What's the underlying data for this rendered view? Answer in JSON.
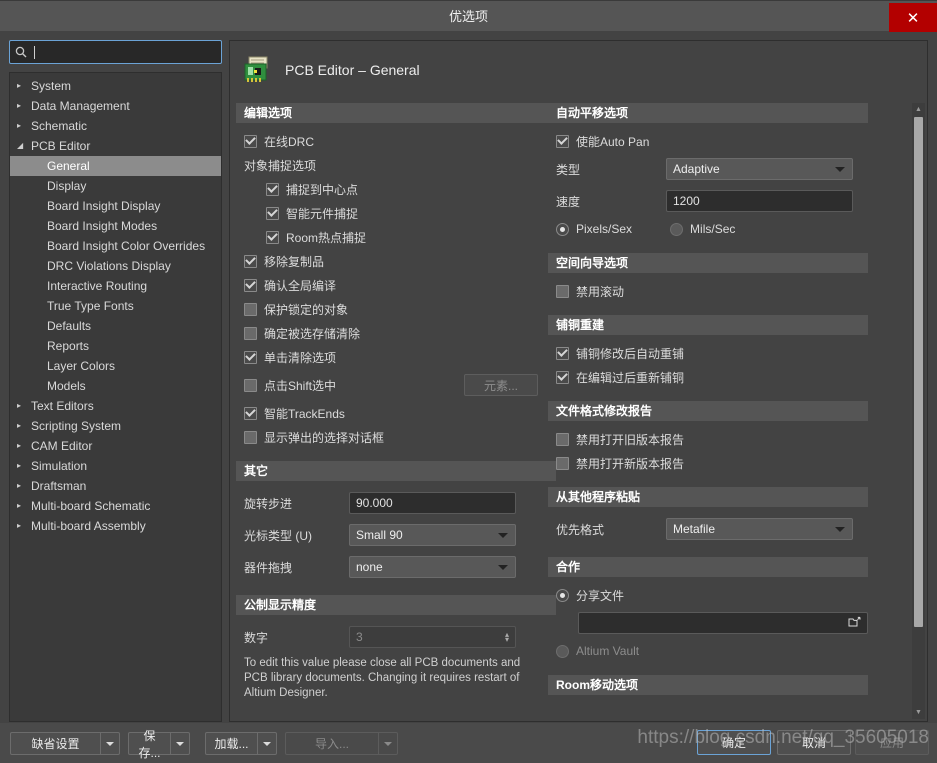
{
  "window": {
    "title": "优选项",
    "close_label": "✕"
  },
  "search": {
    "placeholder": "",
    "value": "",
    "icon": "search-icon"
  },
  "sidebar": {
    "items": [
      {
        "label": "System",
        "level": 0,
        "arrow": "▸",
        "selected": false
      },
      {
        "label": "Data Management",
        "level": 0,
        "arrow": "▸",
        "selected": false
      },
      {
        "label": "Schematic",
        "level": 0,
        "arrow": "▸",
        "selected": false
      },
      {
        "label": "PCB Editor",
        "level": 0,
        "arrow": "◢",
        "selected": false
      },
      {
        "label": "General",
        "level": 1,
        "arrow": "",
        "selected": true
      },
      {
        "label": "Display",
        "level": 1,
        "arrow": "",
        "selected": false
      },
      {
        "label": "Board Insight Display",
        "level": 1,
        "arrow": "",
        "selected": false
      },
      {
        "label": "Board Insight Modes",
        "level": 1,
        "arrow": "",
        "selected": false
      },
      {
        "label": "Board Insight Color Overrides",
        "level": 1,
        "arrow": "",
        "selected": false
      },
      {
        "label": "DRC Violations Display",
        "level": 1,
        "arrow": "",
        "selected": false
      },
      {
        "label": "Interactive Routing",
        "level": 1,
        "arrow": "",
        "selected": false
      },
      {
        "label": "True Type Fonts",
        "level": 1,
        "arrow": "",
        "selected": false
      },
      {
        "label": "Defaults",
        "level": 1,
        "arrow": "",
        "selected": false
      },
      {
        "label": "Reports",
        "level": 1,
        "arrow": "",
        "selected": false
      },
      {
        "label": "Layer Colors",
        "level": 1,
        "arrow": "",
        "selected": false
      },
      {
        "label": "Models",
        "level": 1,
        "arrow": "",
        "selected": false
      },
      {
        "label": "Text Editors",
        "level": 0,
        "arrow": "▸",
        "selected": false
      },
      {
        "label": "Scripting System",
        "level": 0,
        "arrow": "▸",
        "selected": false
      },
      {
        "label": "CAM Editor",
        "level": 0,
        "arrow": "▸",
        "selected": false
      },
      {
        "label": "Simulation",
        "level": 0,
        "arrow": "▸",
        "selected": false
      },
      {
        "label": "Draftsman",
        "level": 0,
        "arrow": "▸",
        "selected": false
      },
      {
        "label": "Multi-board Schematic",
        "level": 0,
        "arrow": "▸",
        "selected": false
      },
      {
        "label": "Multi-board Assembly",
        "level": 0,
        "arrow": "▸",
        "selected": false
      }
    ]
  },
  "panel": {
    "title": "PCB Editor – General",
    "icon": "pcb-board-icon"
  },
  "edit_options": {
    "header": "编辑选项",
    "online_drc": {
      "label": "在线DRC",
      "checked": true
    },
    "snap_group_label": "对象捕捉选项",
    "snap_center": {
      "label": "捕捉到中心点",
      "checked": true
    },
    "snap_smart_component": {
      "label": "智能元件捕捉",
      "checked": true
    },
    "snap_room_hotspot": {
      "label": "Room热点捕捉",
      "checked": true
    },
    "remove_duplicates": {
      "label": "移除复制品",
      "checked": true
    },
    "confirm_global_edit": {
      "label": "确认全局编译",
      "checked": true
    },
    "protect_locked": {
      "label": "保护锁定的对象",
      "checked": false
    },
    "confirm_selection_memory_clear": {
      "label": "确定被选存储清除",
      "checked": false
    },
    "click_clears_selection": {
      "label": "单击清除选项",
      "checked": true
    },
    "shift_click_to_select": {
      "label": "点击Shift选中",
      "checked": false
    },
    "primitives_button": "元素...",
    "smart_track_ends": {
      "label": "智能TrackEnds",
      "checked": true
    },
    "display_popup_select": {
      "label": "显示弹出的选择对话框",
      "checked": false
    }
  },
  "other": {
    "header": "其它",
    "rotation_step": {
      "label": "旋转步进",
      "value": "90.000"
    },
    "cursor_type": {
      "label": "光标类型 (U)",
      "value": "Small 90"
    },
    "comp_drag": {
      "label": "器件拖拽",
      "value": "none"
    }
  },
  "metric_precision": {
    "header": "公制显示精度",
    "digits": {
      "label": "数字",
      "value": "3"
    },
    "note": "To edit this value please close all PCB documents and PCB library documents. Changing it requires restart of Altium Designer."
  },
  "auto_pan": {
    "header": "自动平移选项",
    "enable": {
      "label": "使能Auto Pan",
      "checked": true
    },
    "style": {
      "label": "类型",
      "value": "Adaptive"
    },
    "speed": {
      "label": "速度",
      "value": "1200"
    },
    "unit_pixels": {
      "label": "Pixels/Sex",
      "selected": true
    },
    "unit_mils": {
      "label": "Mils/Sec",
      "selected": false
    }
  },
  "space_navigator": {
    "header": "空间向导选项",
    "disable_rolling": {
      "label": "禁用滚动",
      "checked": false
    }
  },
  "polygon_rebuild": {
    "header": "铺铜重建",
    "repour_after_edit": {
      "label": "铺铜修改后自动重铺",
      "checked": true
    },
    "repour_after_modified": {
      "label": "在编辑过后重新铺铜",
      "checked": true
    }
  },
  "file_format_report": {
    "header": "文件格式修改报告",
    "disable_older": {
      "label": "禁用打开旧版本报告",
      "checked": false
    },
    "disable_newer": {
      "label": "禁用打开新版本报告",
      "checked": false
    }
  },
  "paste_from_other": {
    "header": "从其他程序粘贴",
    "priority_format": {
      "label": "优先格式",
      "value": "Metafile"
    }
  },
  "collaboration": {
    "header": "合作",
    "shared_file": {
      "label": "分享文件",
      "selected": true
    },
    "path_value": "",
    "browse_icon": "folder-open-icon",
    "altium_vault": {
      "label": "Altium Vault",
      "selected": false
    }
  },
  "room_move": {
    "header": "Room移动选项"
  },
  "footer": {
    "defaults": "缺省设置",
    "save": "保存...",
    "load": "加载...",
    "import": "导入...",
    "ok": "确定",
    "cancel": "取消",
    "apply": "应用"
  },
  "watermark": "https://blog.csdn.net/qq_35605018",
  "colors": {
    "accent": "#6ba3d6",
    "close": "#b30000",
    "section_header_bg": "#555555",
    "selection": "#8c8c8c"
  }
}
